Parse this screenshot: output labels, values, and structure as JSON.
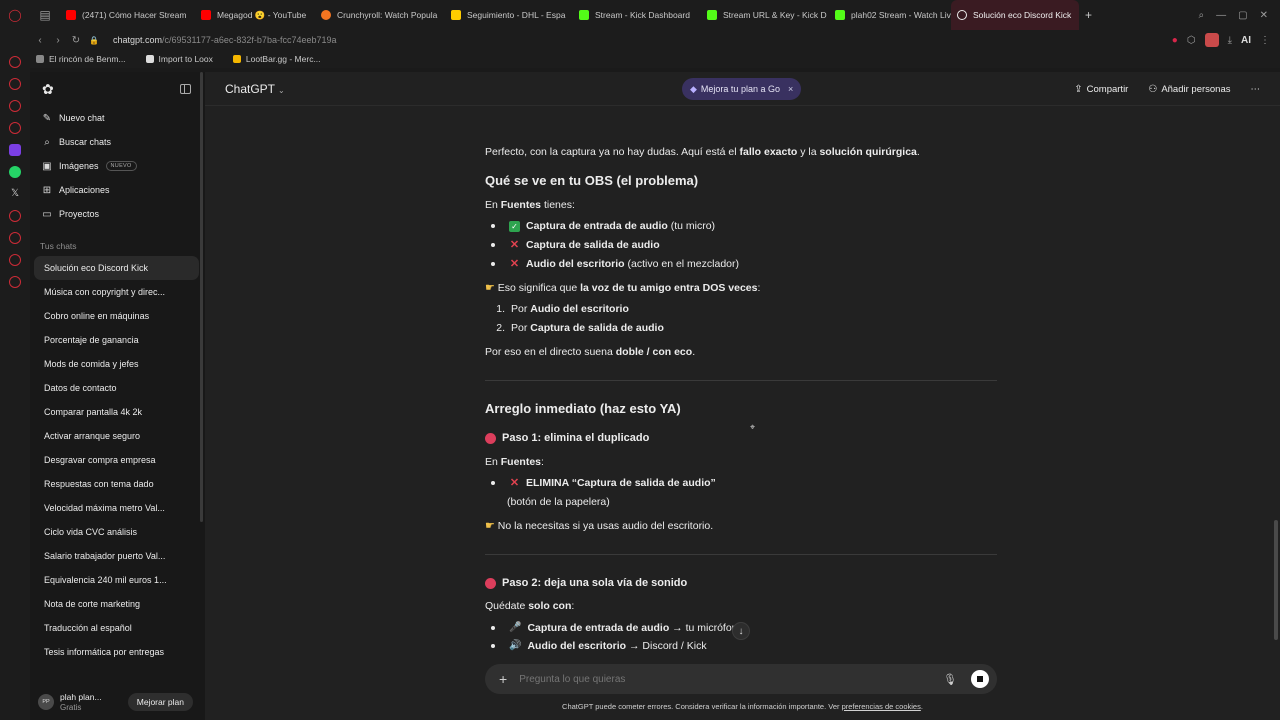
{
  "browser": {
    "tabs": [
      {
        "title": "(2471) Cómo Hacer Stream",
        "color": "#ff0000"
      },
      {
        "title": "Megagod 😮 - YouTube",
        "color": "#ff0000"
      },
      {
        "title": "Crunchyroll: Watch Popula",
        "color": "#f47521"
      },
      {
        "title": "Seguimiento - DHL - Espa",
        "color": "#ffcc00"
      },
      {
        "title": "Stream - Kick Dashboard",
        "color": "#53fc18"
      },
      {
        "title": "Stream URL & Key - Kick D",
        "color": "#53fc18"
      },
      {
        "title": "plah02 Stream - Watch Liv",
        "color": "#53fc18"
      },
      {
        "title": "Solución eco Discord Kick",
        "color": "#ececec",
        "active": true
      }
    ],
    "new_tab": "+",
    "url_host": "chatgpt.com",
    "url_path": "/c/69531177-a6ec-832f-b7ba-fcc74eeb719a",
    "ai_label": "AI",
    "bookmarks": [
      "El rincón de Benm...",
      "Import to Loox",
      "LootBar.gg - Merc..."
    ]
  },
  "sidebar": {
    "nav": [
      {
        "label": "Nuevo chat",
        "icon": "✎"
      },
      {
        "label": "Buscar chats",
        "icon": "⌕"
      },
      {
        "label": "Imágenes",
        "icon": "▣",
        "badge": "NUEVO"
      },
      {
        "label": "Aplicaciones",
        "icon": "⊞"
      },
      {
        "label": "Proyectos",
        "icon": "▭"
      }
    ],
    "section_title": "Tus chats",
    "chats": [
      "Solución eco Discord Kick",
      "Música con copyright y direc...",
      "Cobro online en máquinas",
      "Porcentaje de ganancia",
      "Mods de comida y jefes",
      "Datos de contacto",
      "Comparar pantalla 4k 2k",
      "Activar arranque seguro",
      "Desgravar compra empresa",
      "Respuestas con tema dado",
      "Velocidad máxima metro Val...",
      "Ciclo vida CVC análisis",
      "Salario trabajador puerto Val...",
      "Equivalencia 240 mil euros 1...",
      "Nota de corte marketing",
      "Traducción al español",
      "Tesis informática por entregas"
    ],
    "user": {
      "initials": "PP",
      "name": "plah plan...",
      "plan": "Gratis"
    },
    "upgrade_label": "Mejorar plan"
  },
  "header": {
    "model": "ChatGPT",
    "promo": "Mejora tu plan a Go",
    "promo_close": "×",
    "share": "Compartir",
    "add_people": "Añadir personas",
    "more": "⋯"
  },
  "message": {
    "intro_a": "Perfecto, con la captura ya no hay dudas. Aquí está el ",
    "intro_b": "fallo exacto",
    "intro_c": " y la ",
    "intro_d": "solución quirúrgica",
    "intro_e": ".",
    "h_problem": "Qué se ve en tu OBS (el problema)",
    "fuentes_a": "En ",
    "fuentes_b": "Fuentes",
    "fuentes_c": " tienes:",
    "src1_b": "Captura de entrada de audio",
    "src1_c": " (tu micro)",
    "src2_b": "Captura de salida de audio",
    "src3_b": "Audio del escritorio",
    "src3_c": " (activo en el mezclador)",
    "means_a": " Eso significa que ",
    "means_b": "la voz de tu amigo entra DOS veces",
    "means_c": ":",
    "o1_num": "1.",
    "o1_a": "Por ",
    "o1_b": "Audio del escritorio",
    "o2_num": "2.",
    "o2_a": "Por ",
    "o2_b": "Captura de salida de audio",
    "why_a": "Por eso en el directo suena ",
    "why_b": "doble / con eco",
    "why_c": ".",
    "h_fix": "Arreglo inmediato (haz esto YA)",
    "step1": "Paso 1: elimina el duplicado",
    "en_fuentes_a": "En ",
    "en_fuentes_b": "Fuentes",
    "en_fuentes_c": ":",
    "elim_b": "ELIMINA “Captura de salida de audio”",
    "elim_sub": "(botón de la papelera)",
    "no_need": " No la necesitas si ya usas audio del escritorio.",
    "step2": "Paso 2: deja una sola vía de sonido",
    "quedate_a": "Quédate ",
    "quedate_b": "solo con",
    "quedate_c": ":",
    "keep1_b": "Captura de entrada de audio",
    "keep1_c": " → tu micrófono",
    "keep2_b": "Audio del escritorio",
    "keep2_c": " → Discord / Kick"
  },
  "composer": {
    "placeholder": "Pregunta lo que quieras"
  },
  "footer": {
    "text": "ChatGPT puede cometer errores. Considera verificar la información importante. Ver ",
    "link": "preferencias de cookies",
    "end": "."
  }
}
